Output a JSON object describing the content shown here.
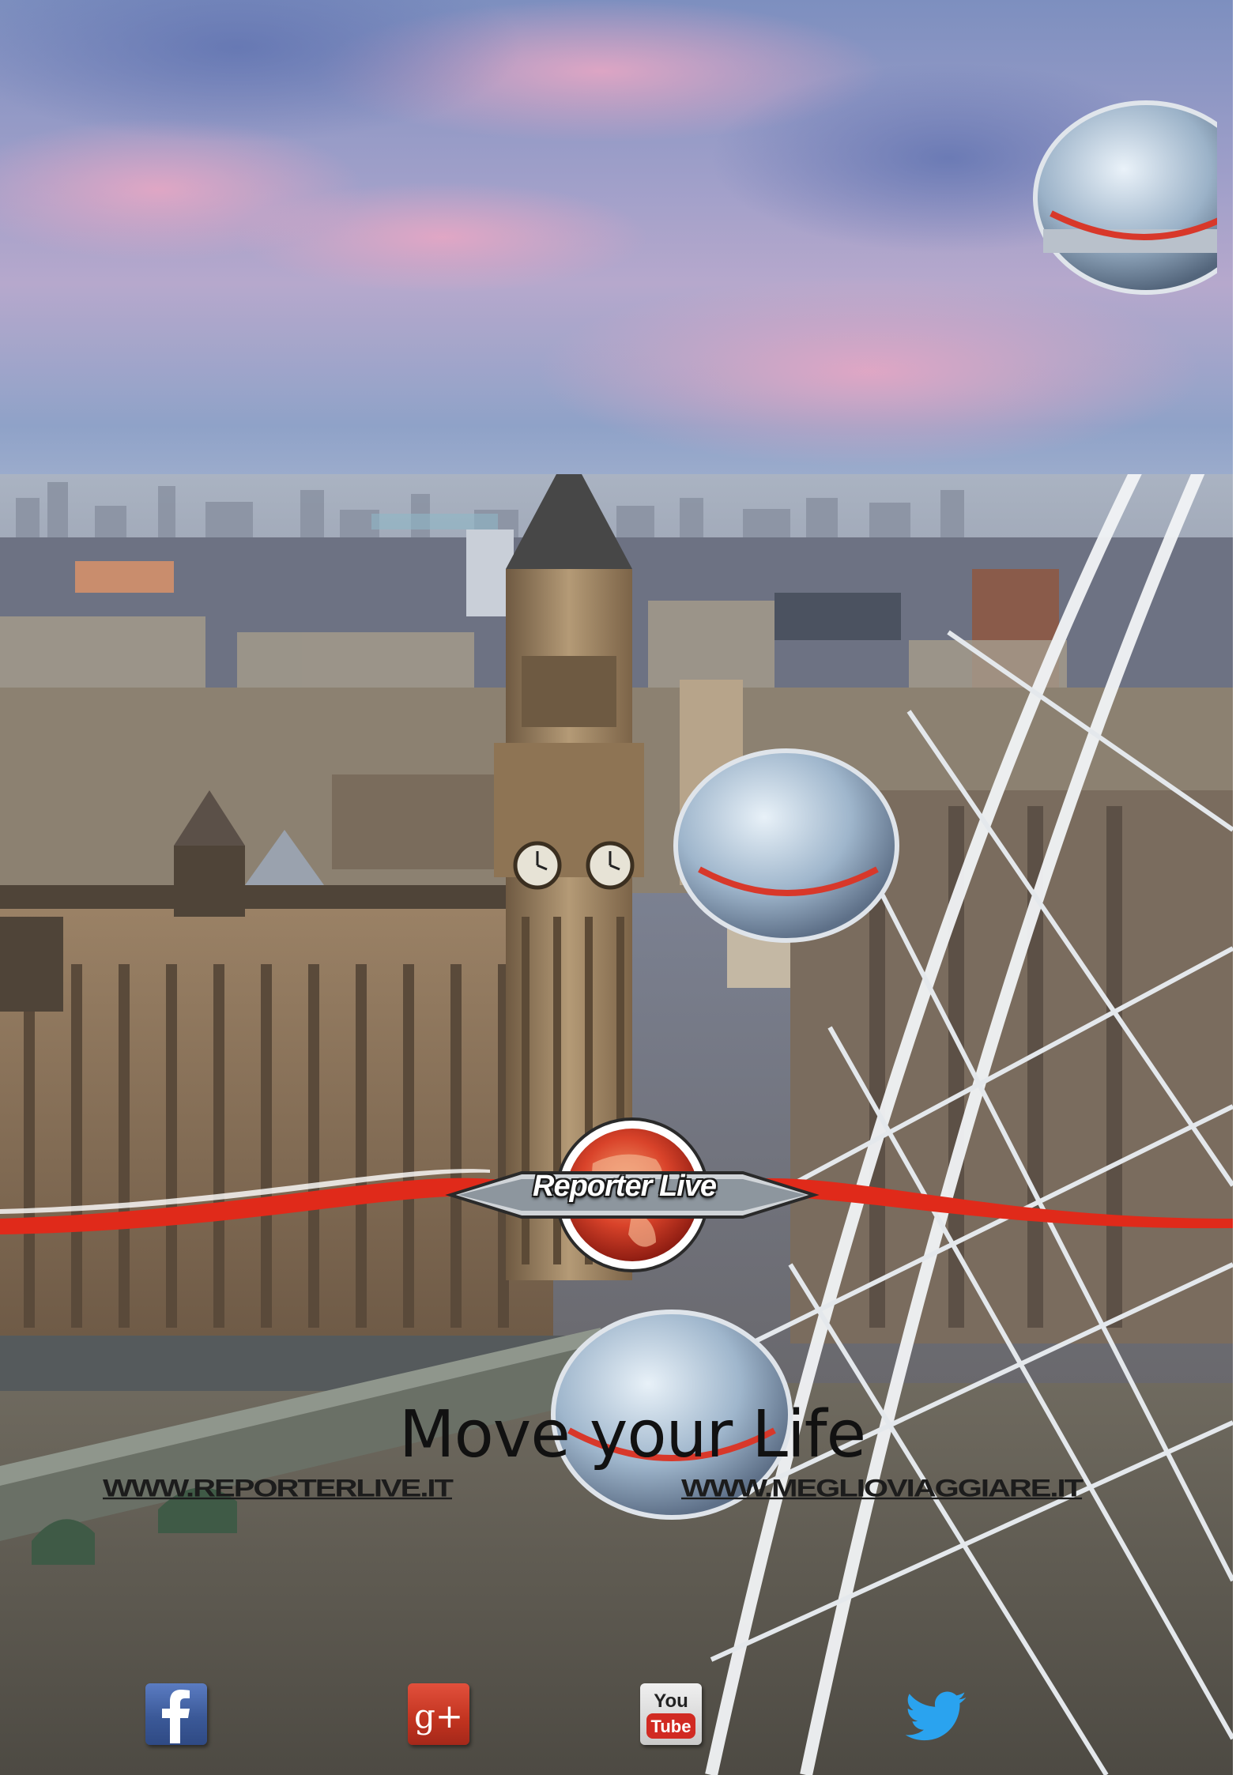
{
  "brand": {
    "name": "Reporter Live"
  },
  "tagline": "Move your Life",
  "links": {
    "site1": "WWW.REPORTERLIVE.IT",
    "site2": "WWW.MEGLIOVIAGGIARE.IT"
  },
  "social": [
    "facebook-icon",
    "google-plus-icon",
    "youtube-icon",
    "twitter-icon"
  ],
  "social_text": {
    "youtube_top": "You",
    "youtube_bottom": "Tube",
    "gplus": "g+"
  },
  "colors": {
    "accent_red": "#e02a1a",
    "sky_purple": "#a79bc9",
    "text": "#111111"
  }
}
